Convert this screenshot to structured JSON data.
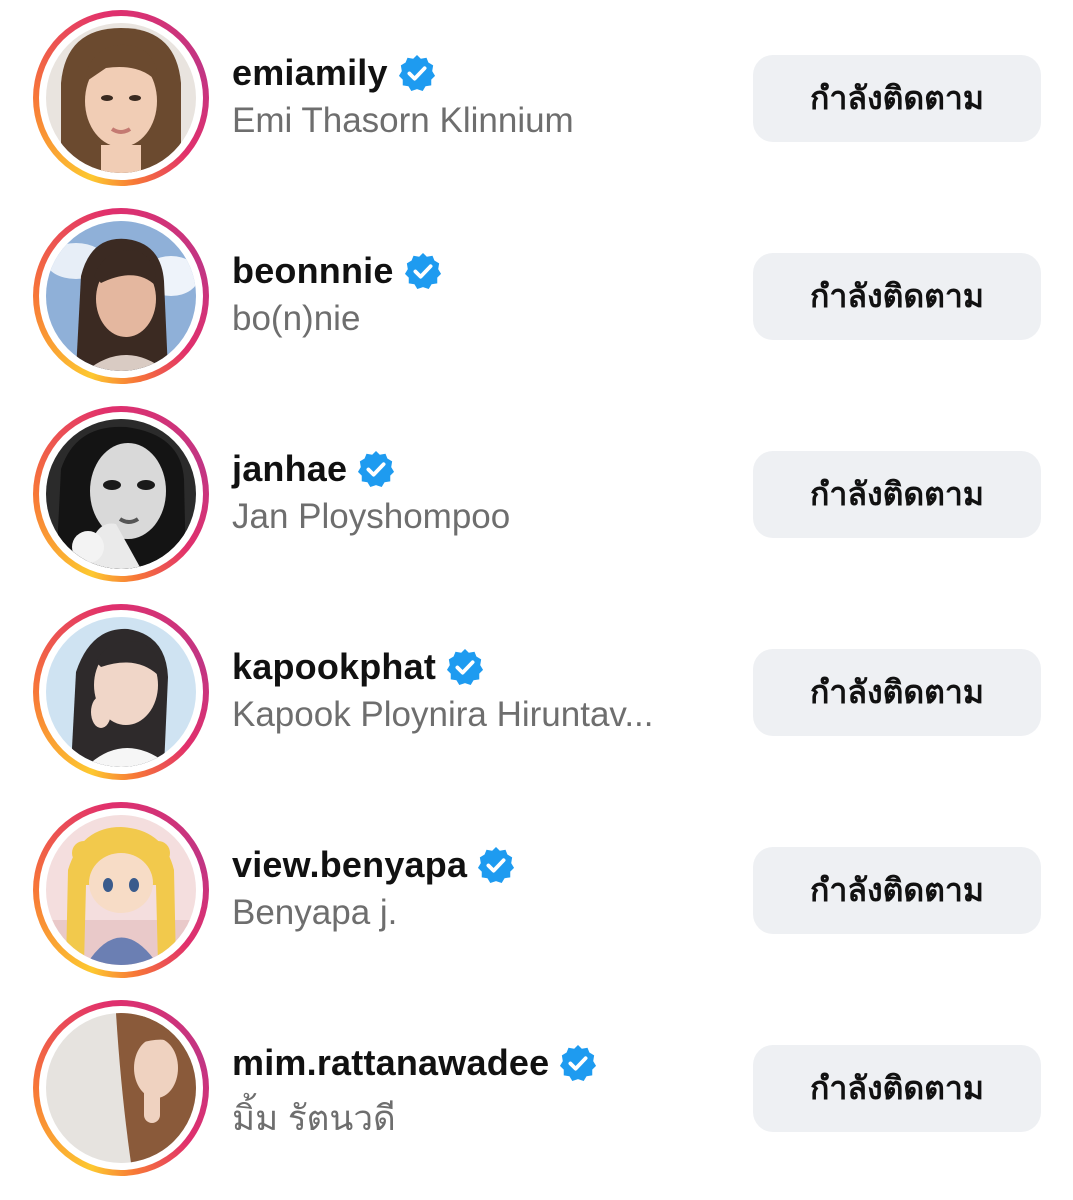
{
  "accent": {
    "verified_badge": "#1e9bf0",
    "button_bg": "#eef0f3",
    "fullname_color": "#6e6e6e"
  },
  "following_button_label": "กำลังติดตาม",
  "badge_icon": "verified-badge-icon",
  "users": [
    {
      "username": "emiamily",
      "full_name": "Emi Thasorn Klinnium",
      "verified": true,
      "following_label": "กำลังติดตาม"
    },
    {
      "username": "beonnnie",
      "full_name": "bo(n)nie",
      "verified": true,
      "following_label": "กำลังติดตาม"
    },
    {
      "username": "janhae",
      "full_name": "Jan Ployshompoo",
      "verified": true,
      "following_label": "กำลังติดตาม"
    },
    {
      "username": "kapookphat",
      "full_name": "Kapook Ploynira Hiruntav...",
      "verified": true,
      "following_label": "กำลังติดตาม"
    },
    {
      "username": "view.benyapa",
      "full_name": "Benyapa j.",
      "verified": true,
      "following_label": "กำลังติดตาม"
    },
    {
      "username": "mim.rattanawadee",
      "full_name": "มิ้ม รัตนวดี",
      "verified": true,
      "following_label": "กำลังติดตาม"
    }
  ]
}
